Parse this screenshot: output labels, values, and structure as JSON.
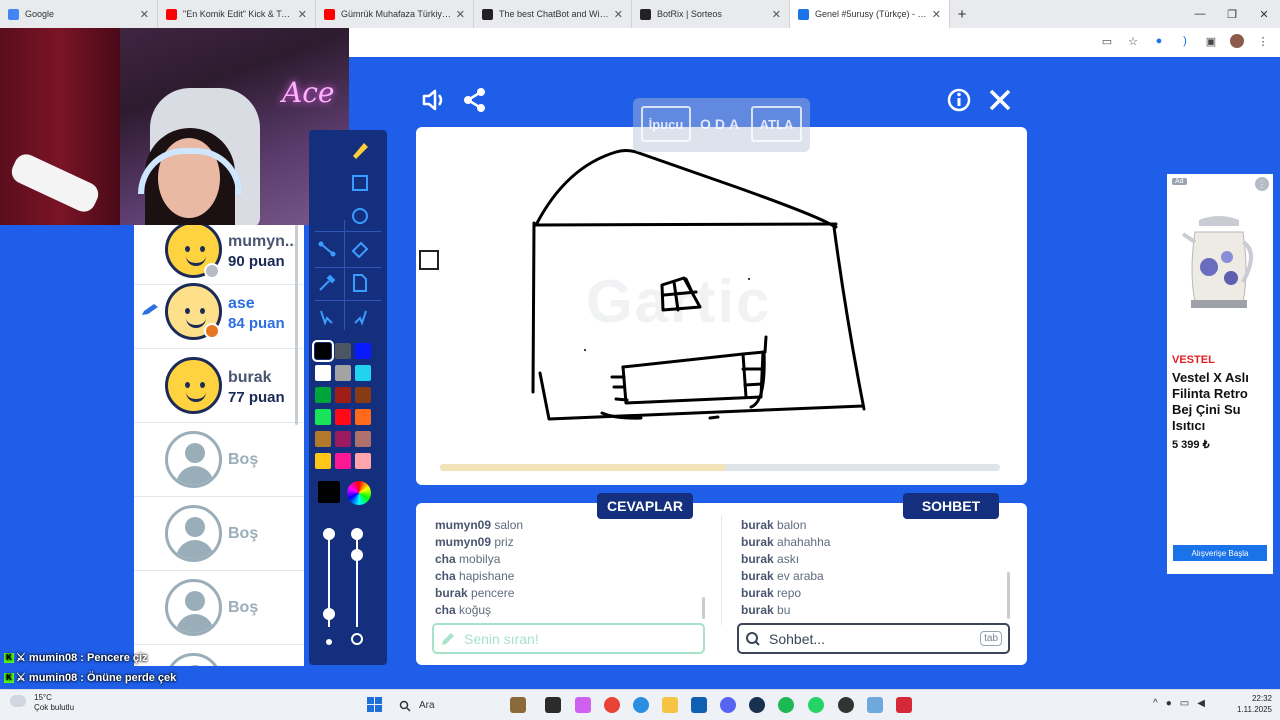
{
  "browser": {
    "tabs": [
      {
        "label": "Google",
        "color": "#4285f4"
      },
      {
        "label": "\"En Komik Edit\" Kick & Twitch I",
        "color": "#ff0000"
      },
      {
        "label": "Gümrük Muhafaza Türkiye 16.1",
        "color": "#ff0000"
      },
      {
        "label": "The best ChatBot and Widgets",
        "color": "#222222"
      },
      {
        "label": "BotRix | Sorteos",
        "color": "#222222"
      },
      {
        "label": "Genel #5urusy (Türkçe) - Gartic",
        "color": "#1a73e8"
      }
    ],
    "new_tab": "+",
    "window_controls": [
      "—",
      "❐",
      "✕"
    ]
  },
  "webcam": {
    "neon_text": "Ace"
  },
  "players": [
    {
      "name": "mumyn...",
      "score": "90 puan",
      "type": "player",
      "dot_color": "#b7bcc5"
    },
    {
      "name": "ase",
      "score": "84 puan",
      "type": "me",
      "dot_color": "#e87722"
    },
    {
      "name": "burak",
      "score": "77 puan",
      "type": "player"
    },
    {
      "name": "Boş",
      "type": "empty"
    },
    {
      "name": "Boş",
      "type": "empty"
    },
    {
      "name": "Boş",
      "type": "empty"
    }
  ],
  "palette": [
    [
      "#000000",
      "#4e5563",
      "#0a1aff"
    ],
    [
      "#ffffff",
      "#a3a3a3",
      "#22d3f0"
    ],
    [
      "#00a53a",
      "#a01e16",
      "#863b12"
    ],
    [
      "#19e35a",
      "#ff0a16",
      "#ff6a1a"
    ],
    [
      "#b07a2a",
      "#991a5e",
      "#b0706b"
    ],
    [
      "#ffc61a",
      "#ff1793",
      "#ffa3ad"
    ]
  ],
  "hint": {
    "hint_button": "İpucu",
    "room_label": "ODA",
    "skip_button": "ATLA"
  },
  "canvas": {
    "watermark": "Gartic",
    "progress": 0.51
  },
  "answers": {
    "title": "CEVAPLAR",
    "messages": [
      {
        "user": "mumyn09",
        "text": "salon"
      },
      {
        "user": "mumyn09",
        "text": "priz"
      },
      {
        "user": "cha",
        "text": "mobilya"
      },
      {
        "user": "cha",
        "text": "hapishane"
      },
      {
        "user": "burak",
        "text": "pencere"
      },
      {
        "user": "cha",
        "text": "koğuş"
      }
    ],
    "input_placeholder": "Senin sıran!"
  },
  "chat": {
    "title": "SOHBET",
    "messages": [
      {
        "user": "burak",
        "text": "balon"
      },
      {
        "user": "burak",
        "text": "ahahahha"
      },
      {
        "user": "burak",
        "text": "askı"
      },
      {
        "user": "burak",
        "text": "ev araba"
      },
      {
        "user": "burak",
        "text": "repo"
      },
      {
        "user": "burak",
        "text": "bu"
      }
    ],
    "input_placeholder": "Sohbet...",
    "tab_key": "tab"
  },
  "ad": {
    "badge": "Ad",
    "info": "⋮",
    "brand": "VESTEL",
    "title": "Vestel X Aslı Filinta Retro Bej Çini Su Isıtıcı",
    "price": "5 399 ₺",
    "button": "Alışverişe Başla"
  },
  "stream_chat": [
    {
      "user": "mumin08",
      "text": "Pencere çiz"
    },
    {
      "user": "mumin08",
      "text": "Önüne perde çek"
    }
  ],
  "taskbar": {
    "weather_temp": "15°C",
    "weather_desc": "Çok bulutlu",
    "search_label": "Ara",
    "time": "22:32",
    "date": "1.11.2025"
  },
  "colors": {
    "game_blue": "#1f5ee8",
    "panel_navy": "#132f7d",
    "accent": "#2c6fe0"
  }
}
